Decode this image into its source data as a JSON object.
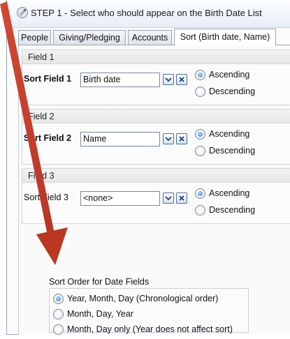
{
  "window": {
    "title": "STEP 1 - Select who should appear on the Birth Date List"
  },
  "tabs": [
    {
      "label": "People"
    },
    {
      "label": "Giving/Pledging"
    },
    {
      "label": "Accounts"
    },
    {
      "label": "Sort (Birth date, Name)",
      "active": true
    }
  ],
  "fields": [
    {
      "header": "Field 1",
      "label": "Sort Field 1",
      "value": "Birth date",
      "ascending": "Ascending",
      "descending": "Descending",
      "selected": "Ascending"
    },
    {
      "header": "Field 2",
      "label": "Sort Field 2",
      "value": "Name",
      "ascending": "Ascending",
      "descending": "Descending",
      "selected": "Ascending"
    },
    {
      "header": "Field 3",
      "label": "Sort Field 3",
      "value": "<none>",
      "ascending": "Ascending",
      "descending": "Descending",
      "selected": "Ascending"
    }
  ],
  "sort_order": {
    "title": "Sort Order for Date Fields",
    "options": [
      {
        "label": "Year, Month, Day (Chronological order)",
        "selected": true
      },
      {
        "label": "Month, Day, Year",
        "selected": false
      },
      {
        "label": "Month, Day only (Year does not affect sort)",
        "selected": false
      }
    ]
  },
  "colors": {
    "annotation_arrow": "#c0392b",
    "accent": "#3a86d6"
  },
  "icons": [
    "app-icon",
    "dropdown-arrow-icon",
    "clear-x-icon",
    "annotation-arrow"
  ]
}
